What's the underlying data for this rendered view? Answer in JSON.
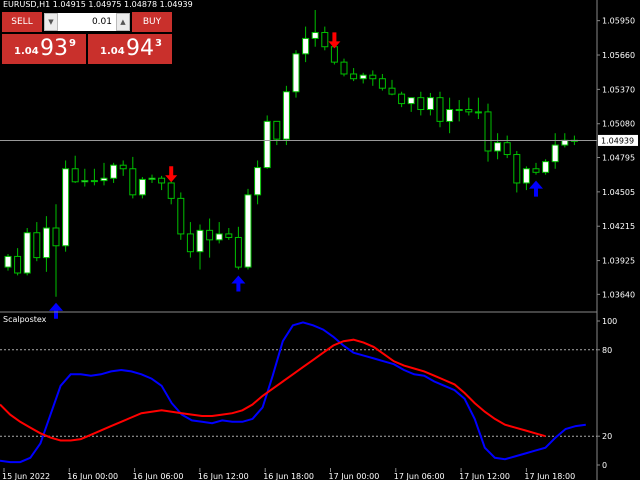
{
  "chart_title": "EURUSD,H1  1.04915 1.04975 1.04878 1.04939",
  "trade_panel": {
    "sell_label": "SELL",
    "buy_label": "BUY",
    "lot_value": "0.01",
    "sell_price": {
      "prefix": "1.04",
      "big": "93",
      "sup": "9"
    },
    "buy_price": {
      "prefix": "1.04",
      "big": "94",
      "sup": "3"
    }
  },
  "price_axis": [
    "1.05950",
    "1.05660",
    "1.05370",
    "1.05080",
    "1.04795",
    "1.04505",
    "1.04215",
    "1.03925",
    "1.03640"
  ],
  "current_price": "1.04939",
  "indicator": {
    "name": "Scalpostex",
    "axis": [
      "100",
      "80",
      "20",
      "0"
    ],
    "levels": [
      80,
      20
    ]
  },
  "time_axis": [
    "15 Jun 2022",
    "16 Jun 00:00",
    "16 Jun 06:00",
    "16 Jun 12:00",
    "16 Jun 18:00",
    "17 Jun 00:00",
    "17 Jun 06:00",
    "17 Jun 12:00",
    "17 Jun 18:00"
  ],
  "colors": {
    "bull": "#ffffff",
    "bear": "#000000",
    "wick": "#00c000",
    "sell_arrow": "#ff0000",
    "buy_arrow": "#0000ff",
    "blue_line": "#0000ff",
    "red_line": "#ff0000",
    "panel_red": "#c9302c"
  },
  "chart_data": {
    "type": "candlestick",
    "price_range": [
      1.0355,
      1.0604
    ],
    "candles": [
      [
        1.0387,
        1.0398,
        1.0384,
        1.0396
      ],
      [
        1.0396,
        1.0403,
        1.038,
        1.0382
      ],
      [
        1.0382,
        1.042,
        1.038,
        1.0416
      ],
      [
        1.0416,
        1.0425,
        1.0392,
        1.0395
      ],
      [
        1.0395,
        1.043,
        1.0383,
        1.042
      ],
      [
        1.042,
        1.044,
        1.0362,
        1.0405
      ],
      [
        1.0405,
        1.0477,
        1.04,
        1.047
      ],
      [
        1.047,
        1.0481,
        1.0458,
        1.0459
      ],
      [
        1.0459,
        1.047,
        1.0455,
        1.046
      ],
      [
        1.046,
        1.047,
        1.0456,
        1.046
      ],
      [
        1.046,
        1.0475,
        1.0456,
        1.0462
      ],
      [
        1.0462,
        1.0475,
        1.0458,
        1.0473
      ],
      [
        1.0473,
        1.0477,
        1.0464,
        1.047
      ],
      [
        1.047,
        1.048,
        1.0445,
        1.0448
      ],
      [
        1.0448,
        1.0463,
        1.0445,
        1.0461
      ],
      [
        1.0461,
        1.0465,
        1.0458,
        1.0462
      ],
      [
        1.0462,
        1.0464,
        1.0452,
        1.0458
      ],
      [
        1.0458,
        1.0462,
        1.044,
        1.0445
      ],
      [
        1.0445,
        1.045,
        1.041,
        1.0415
      ],
      [
        1.0415,
        1.0425,
        1.0395,
        1.04
      ],
      [
        1.04,
        1.0423,
        1.0385,
        1.0418
      ],
      [
        1.0418,
        1.0428,
        1.0395,
        1.041
      ],
      [
        1.041,
        1.0425,
        1.0407,
        1.0415
      ],
      [
        1.0415,
        1.042,
        1.041,
        1.0412
      ],
      [
        1.0412,
        1.0421,
        1.0385,
        1.0387
      ],
      [
        1.0387,
        1.0453,
        1.0385,
        1.0448
      ],
      [
        1.0448,
        1.0477,
        1.044,
        1.0471
      ],
      [
        1.0471,
        1.0515,
        1.047,
        1.051
      ],
      [
        1.051,
        1.051,
        1.049,
        1.0495
      ],
      [
        1.0495,
        1.054,
        1.049,
        1.0535
      ],
      [
        1.0535,
        1.057,
        1.053,
        1.0567
      ],
      [
        1.0567,
        1.059,
        1.056,
        1.058
      ],
      [
        1.058,
        1.0604,
        1.0573,
        1.0585
      ],
      [
        1.0585,
        1.059,
        1.057,
        1.0573
      ],
      [
        1.0573,
        1.0575,
        1.0558,
        1.056
      ],
      [
        1.056,
        1.0563,
        1.0548,
        1.055
      ],
      [
        1.055,
        1.0555,
        1.0544,
        1.0546
      ],
      [
        1.0546,
        1.0551,
        1.0542,
        1.0549
      ],
      [
        1.0549,
        1.0553,
        1.054,
        1.0546
      ],
      [
        1.0546,
        1.055,
        1.0536,
        1.0538
      ],
      [
        1.0538,
        1.0545,
        1.0532,
        1.0533
      ],
      [
        1.0533,
        1.0535,
        1.0522,
        1.0525
      ],
      [
        1.0525,
        1.053,
        1.0518,
        1.053
      ],
      [
        1.053,
        1.0535,
        1.0515,
        1.052
      ],
      [
        1.052,
        1.0534,
        1.0515,
        1.053
      ],
      [
        1.053,
        1.0535,
        1.0505,
        1.051
      ],
      [
        1.051,
        1.053,
        1.05,
        1.052
      ],
      [
        1.052,
        1.0528,
        1.051,
        1.052
      ],
      [
        1.052,
        1.053,
        1.0515,
        1.0518
      ],
      [
        1.0518,
        1.053,
        1.0512,
        1.0518
      ],
      [
        1.0518,
        1.0525,
        1.0476,
        1.0485
      ],
      [
        1.0485,
        1.05,
        1.0478,
        1.0492
      ],
      [
        1.0492,
        1.0498,
        1.0479,
        1.0482
      ],
      [
        1.0482,
        1.0485,
        1.045,
        1.0458
      ],
      [
        1.0458,
        1.0472,
        1.0452,
        1.047
      ],
      [
        1.047,
        1.0475,
        1.0465,
        1.0467
      ],
      [
        1.0467,
        1.0478,
        1.0465,
        1.0476
      ],
      [
        1.0476,
        1.05,
        1.047,
        1.049
      ],
      [
        1.049,
        1.05,
        1.0488,
        1.0494
      ],
      [
        1.0494,
        1.0498,
        1.049,
        1.0494
      ]
    ],
    "signals": [
      {
        "type": "buy",
        "candle": 5
      },
      {
        "type": "sell",
        "candle": 17
      },
      {
        "type": "buy",
        "candle": 24
      },
      {
        "type": "sell",
        "candle": 34
      },
      {
        "type": "buy",
        "candle": 55
      }
    ],
    "series": [
      {
        "name": "Scalpostex blue",
        "color": "#0000ff",
        "values": [
          3,
          2,
          2,
          5,
          15,
          35,
          55,
          63,
          63,
          62,
          63,
          65,
          66,
          65,
          63,
          60,
          55,
          43,
          35,
          31,
          30,
          29,
          31,
          30,
          30,
          32,
          40,
          62,
          86,
          97,
          99,
          97,
          94,
          89,
          83,
          78,
          76,
          74,
          72,
          70,
          66,
          63,
          62,
          58,
          55,
          52,
          46,
          32,
          12,
          5,
          4,
          6,
          8,
          10,
          12,
          19,
          25,
          27,
          28
        ],
        "x_index_offset": 0
      },
      {
        "name": "Scalpostex red",
        "color": "#ff0000",
        "values": [
          42,
          35,
          30,
          26,
          22,
          19,
          17,
          17,
          18,
          21,
          24,
          27,
          30,
          33,
          36,
          37,
          38,
          37,
          36,
          35,
          34,
          34,
          35,
          36,
          38,
          42,
          48,
          53,
          58,
          63,
          68,
          73,
          78,
          83,
          86,
          87,
          85,
          82,
          77,
          72,
          69,
          67,
          65,
          62,
          59,
          56,
          50,
          43,
          37,
          32,
          28,
          26,
          24,
          22,
          20
        ],
        "x_index_offset": 0
      }
    ],
    "ylim": [
      0,
      100
    ],
    "levels": [
      80,
      20
    ]
  }
}
